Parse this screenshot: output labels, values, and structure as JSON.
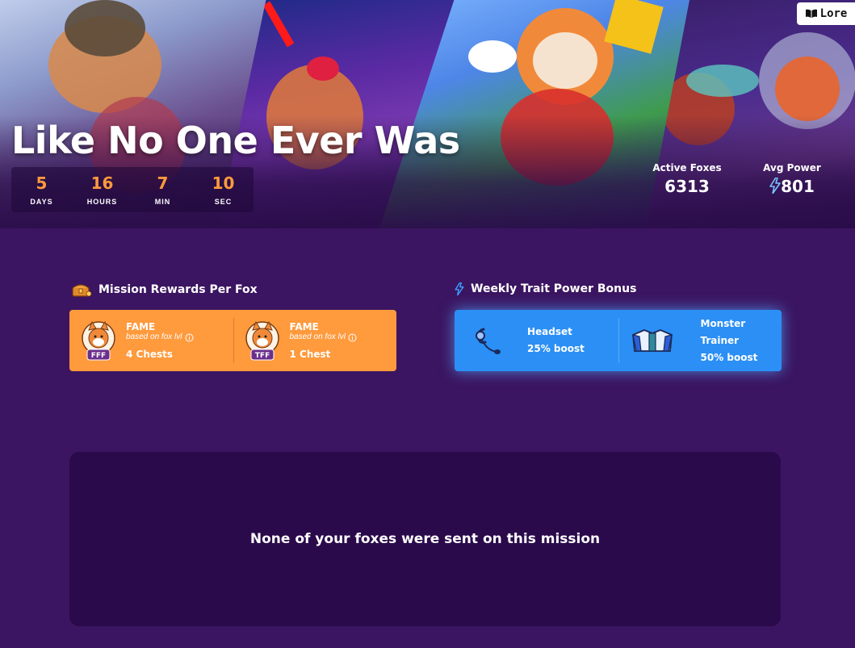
{
  "hero": {
    "title": "Like No One Ever Was",
    "countdown": [
      {
        "value": "5",
        "label": "DAYS"
      },
      {
        "value": "16",
        "label": "HOURS"
      },
      {
        "value": "7",
        "label": "MIN"
      },
      {
        "value": "10",
        "label": "SEC"
      }
    ],
    "stats": {
      "active_label": "Active Foxes",
      "active_value": "6313",
      "power_label": "Avg Power",
      "power_value": "801"
    },
    "lore_label": "Lore"
  },
  "rewards": {
    "heading": "Mission Rewards Per Fox",
    "items": [
      {
        "title": "FAME",
        "sub": "based on fox lvl",
        "count": "4 Chests",
        "badge": "FFF"
      },
      {
        "title": "FAME",
        "sub": "based on fox lvl",
        "count": "1 Chest",
        "badge": "TFF"
      }
    ]
  },
  "bonus": {
    "heading": "Weekly Trait Power Bonus",
    "items": [
      {
        "name": "Headset",
        "boost": "25% boost",
        "icon": "headset-icon"
      },
      {
        "name_line1": "Monster",
        "name_line2": "Trainer",
        "boost": "50% boost",
        "icon": "monster-trainer-icon"
      }
    ]
  },
  "empty_state": {
    "message": "None of your foxes were sent on this mission"
  },
  "colors": {
    "background": "#3b1561",
    "accent_orange": "#ff9a3d",
    "accent_blue": "#2b8ff5",
    "panel_dark": "#2a0a4a"
  }
}
